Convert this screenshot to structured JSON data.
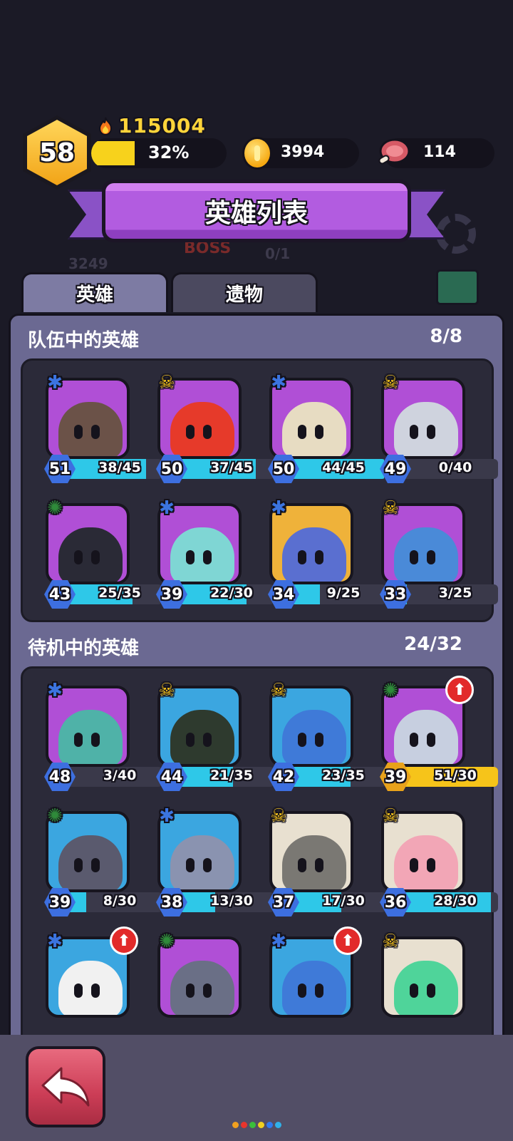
{
  "hud": {
    "level": "58",
    "power": "115004",
    "exp_percent_label": "32%",
    "exp_fraction": 0.32,
    "gold": "3994",
    "meat": "114"
  },
  "banner": {
    "title": "英雄列表"
  },
  "tabs": [
    {
      "label": "英雄",
      "active": true
    },
    {
      "label": "遗物",
      "active": false
    }
  ],
  "team": {
    "title": "队伍中的英雄",
    "count": "8/8",
    "heroes": [
      {
        "level": "51",
        "progress": "38/45",
        "fill": 0.84,
        "cls": "blue",
        "bg": "#b04fd6",
        "body": "#6b5248",
        "upgrade": false,
        "gold": false
      },
      {
        "level": "50",
        "progress": "37/45",
        "fill": 0.82,
        "cls": "gold",
        "bg": "#b04fd6",
        "body": "#e63a2a",
        "upgrade": false,
        "gold": false
      },
      {
        "level": "50",
        "progress": "44/45",
        "fill": 0.98,
        "cls": "blue",
        "bg": "#b04fd6",
        "body": "#e7dcc2",
        "upgrade": false,
        "gold": false
      },
      {
        "level": "49",
        "progress": "0/40",
        "fill": 0.0,
        "cls": "gold",
        "bg": "#b04fd6",
        "body": "#cfd3de",
        "upgrade": false,
        "gold": false
      },
      {
        "level": "43",
        "progress": "25/35",
        "fill": 0.71,
        "cls": "green",
        "bg": "#b04fd6",
        "body": "#2a2a36",
        "upgrade": false,
        "gold": false
      },
      {
        "level": "39",
        "progress": "22/30",
        "fill": 0.73,
        "cls": "blue",
        "bg": "#b04fd6",
        "body": "#7fd6d4",
        "upgrade": false,
        "gold": false
      },
      {
        "level": "34",
        "progress": "9/25",
        "fill": 0.36,
        "cls": "blue",
        "bg": "#efb23a",
        "body": "#5a6fd0",
        "upgrade": false,
        "gold": false
      },
      {
        "level": "33",
        "progress": "3/25",
        "fill": 0.12,
        "cls": "gold",
        "bg": "#b04fd6",
        "body": "#4a8ad8",
        "upgrade": false,
        "gold": false
      }
    ]
  },
  "bench": {
    "title": "待机中的英雄",
    "count": "24/32",
    "heroes": [
      {
        "level": "48",
        "progress": "3/40",
        "fill": 0.08,
        "cls": "blue",
        "bg": "#b04fd6",
        "body": "#4fb2a8",
        "upgrade": false,
        "gold": false
      },
      {
        "level": "44",
        "progress": "21/35",
        "fill": 0.6,
        "cls": "gold",
        "bg": "#3ba6e0",
        "body": "#2e3a2e",
        "upgrade": false,
        "gold": false
      },
      {
        "level": "42",
        "progress": "23/35",
        "fill": 0.66,
        "cls": "gold",
        "bg": "#3ba6e0",
        "body": "#3f7ad8",
        "upgrade": false,
        "gold": false
      },
      {
        "level": "39",
        "progress": "51/30",
        "fill": 1.0,
        "cls": "green",
        "bg": "#b04fd6",
        "body": "#c7cfe0",
        "upgrade": true,
        "gold": true
      },
      {
        "level": "39",
        "progress": "8/30",
        "fill": 0.27,
        "cls": "green",
        "bg": "#3ba6e0",
        "body": "#5a5a6e",
        "upgrade": false,
        "gold": false
      },
      {
        "level": "38",
        "progress": "13/30",
        "fill": 0.43,
        "cls": "blue",
        "bg": "#3ba6e0",
        "body": "#8a93b0",
        "upgrade": false,
        "gold": false
      },
      {
        "level": "37",
        "progress": "17/30",
        "fill": 0.57,
        "cls": "gold",
        "bg": "#e8e0d0",
        "body": "#7a7873",
        "upgrade": false,
        "gold": false
      },
      {
        "level": "36",
        "progress": "28/30",
        "fill": 0.93,
        "cls": "gold",
        "bg": "#e8e0d0",
        "body": "#f2a6b6",
        "upgrade": false,
        "gold": false
      },
      {
        "level": "",
        "progress": "",
        "fill": 0,
        "cls": "blue",
        "bg": "#3ba6e0",
        "body": "#f1f1f1",
        "upgrade": true,
        "gold": false
      },
      {
        "level": "",
        "progress": "",
        "fill": 0,
        "cls": "green",
        "bg": "#b04fd6",
        "body": "#6a6f86",
        "upgrade": false,
        "gold": false
      },
      {
        "level": "",
        "progress": "",
        "fill": 0,
        "cls": "blue",
        "bg": "#3ba6e0",
        "body": "#3f7ad8",
        "upgrade": true,
        "gold": false
      },
      {
        "level": "",
        "progress": "",
        "fill": 0,
        "cls": "gold",
        "bg": "#e8e0d0",
        "body": "#4fd49a",
        "upgrade": false,
        "gold": false
      }
    ]
  },
  "background": {
    "boss_label": "BOSS",
    "boss_progress": "0/1",
    "ghost_number": "3249"
  },
  "icons": {
    "back": "back-arrow-icon",
    "fire": "fire-icon",
    "coin": "gold-coin-icon",
    "meat": "meat-icon",
    "upgrade": "upgrade-arrow-icon"
  },
  "dots": [
    "#f0a020",
    "#e8342c",
    "#3bbf3b",
    "#f0d020",
    "#2f7af0",
    "#30b0e8"
  ]
}
